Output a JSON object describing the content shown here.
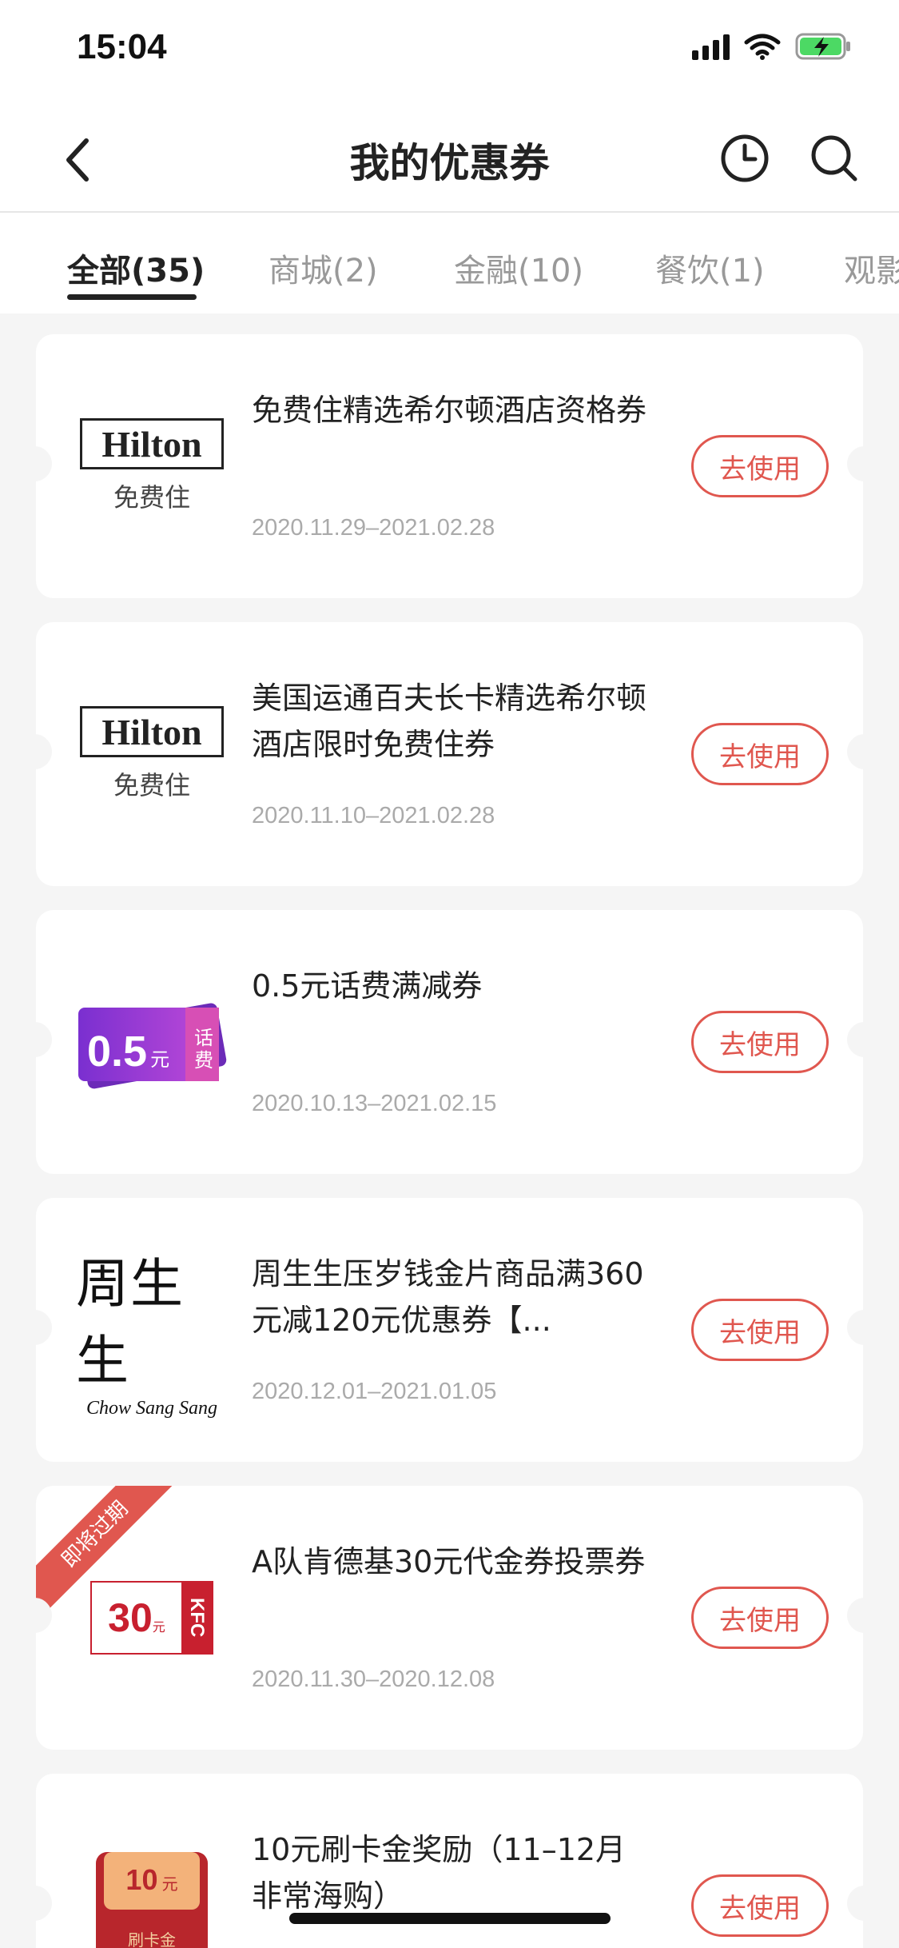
{
  "status": {
    "time": "15:04"
  },
  "nav": {
    "title": "我的优惠券"
  },
  "tabs": [
    {
      "label": "全部(35)"
    },
    {
      "label": "商城(2)"
    },
    {
      "label": "金融(10)"
    },
    {
      "label": "餐饮(1)"
    },
    {
      "label": "观影"
    }
  ],
  "coupons": [
    {
      "title": "免费住精选希尔顿酒店资格券",
      "date": "2020.11.29–2021.02.28",
      "logo_text": "Hilton",
      "logo_sub": "免费住",
      "button": "去使用"
    },
    {
      "title": "美国运通百夫长卡精选希尔顿酒店限时免费住券",
      "date": "2020.11.10–2021.02.28",
      "logo_text": "Hilton",
      "logo_sub": "免费住",
      "button": "去使用"
    },
    {
      "title": "0.5元话费满减券",
      "date": "2020.10.13–2021.02.15",
      "logo_amount": "0.5",
      "logo_unit": "元",
      "logo_tag": "话费",
      "button": "去使用"
    },
    {
      "title": "周生生压岁钱金片商品满360元减120元优惠券【...",
      "date": "2020.12.01–2021.01.05",
      "logo_cn": "周生生",
      "logo_en": "Chow Sang Sang",
      "button": "去使用"
    },
    {
      "badge": "即将过期",
      "title": "A队肯德基30元代金券投票券",
      "date": "2020.11.30–2020.12.08",
      "logo_amount": "30",
      "logo_unit": "元",
      "logo_brand": "KFC",
      "button": "去使用"
    },
    {
      "title": "10元刷卡金奖励（11–12月非常海购）",
      "logo_amount": "10",
      "logo_unit": "元",
      "logo_tag": "刷卡金",
      "button": "去使用"
    }
  ],
  "colors": {
    "accent": "#e0574f",
    "background": "#f5f5f5"
  }
}
